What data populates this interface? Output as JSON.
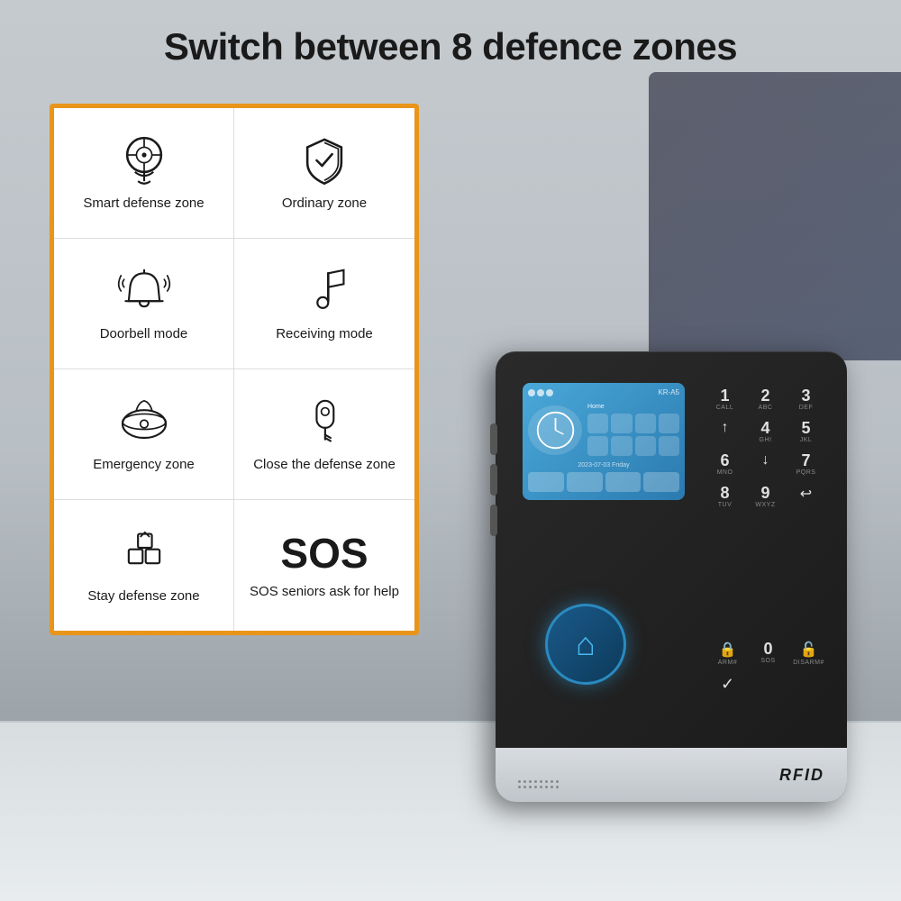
{
  "page": {
    "title": "Switch between 8 defence zones",
    "background_color": "#b0b8c1"
  },
  "features": [
    {
      "id": "smart-defense",
      "icon": "head-gear",
      "label": "Smart defense zone"
    },
    {
      "id": "ordinary-zone",
      "icon": "shield",
      "label": "Ordinary zone"
    },
    {
      "id": "doorbell-mode",
      "icon": "bell",
      "label": "Doorbell mode"
    },
    {
      "id": "receiving-mode",
      "icon": "music-note",
      "label": "Receiving mode"
    },
    {
      "id": "emergency-zone",
      "icon": "smoke-detector",
      "label": "Emergency zone"
    },
    {
      "id": "close-defense",
      "icon": "key",
      "label": "Close the defense zone"
    },
    {
      "id": "stay-defense",
      "icon": "home-boxes",
      "label": "Stay defense zone"
    },
    {
      "id": "sos-help",
      "icon": "sos",
      "label": "SOS seniors ask for help"
    }
  ],
  "device": {
    "brand": "RFID",
    "keypad": [
      {
        "num": "1",
        "letters": "CALL"
      },
      {
        "num": "2",
        "letters": "ABC"
      },
      {
        "num": "3",
        "letters": "DEF"
      },
      {
        "num": "↑",
        "letters": ""
      },
      {
        "num": "4",
        "letters": "GHI"
      },
      {
        "num": "5",
        "letters": "JKL"
      },
      {
        "num": "6",
        "letters": "MNO"
      },
      {
        "num": "↓",
        "letters": ""
      },
      {
        "num": "7",
        "letters": "PQRS"
      },
      {
        "num": "8",
        "letters": "TUV"
      },
      {
        "num": "9",
        "letters": "WXYZ"
      },
      {
        "num": "↩",
        "letters": ""
      },
      {
        "num": "🔒",
        "letters": "ARM#"
      },
      {
        "num": "0",
        "letters": "SOS"
      },
      {
        "num": "🔓",
        "letters": "DISARM#"
      },
      {
        "num": "✓",
        "letters": ""
      }
    ]
  }
}
